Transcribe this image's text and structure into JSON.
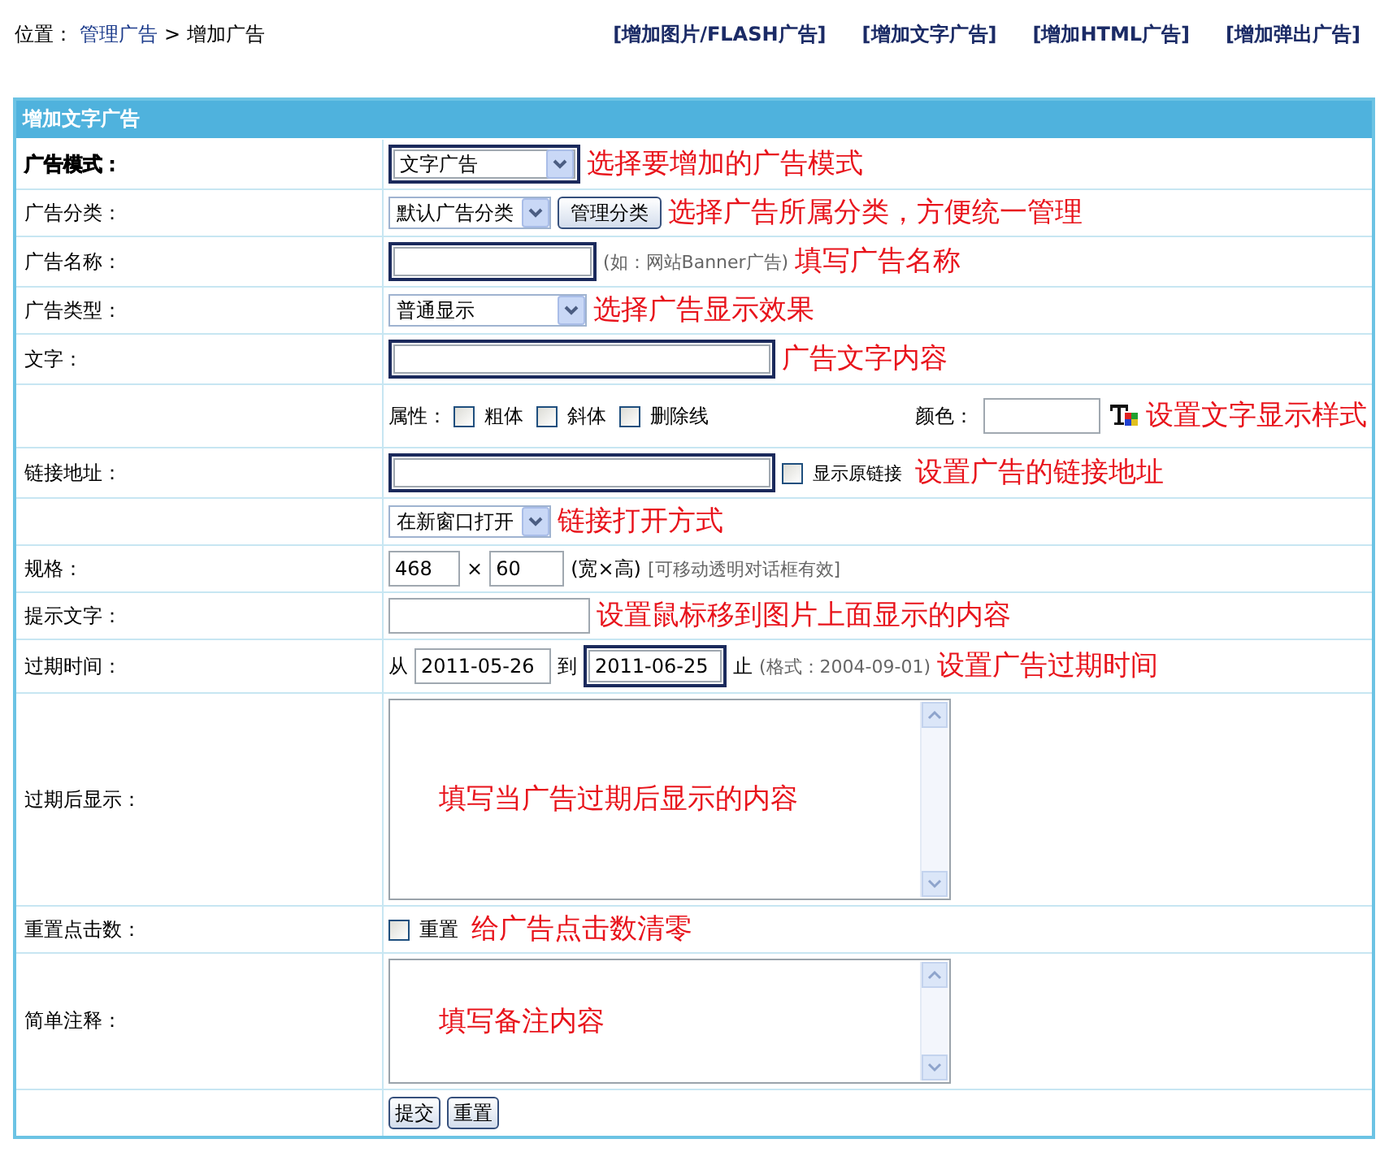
{
  "breadcrumb": {
    "prefix": "位置：",
    "link": "管理广告",
    "separator": ">",
    "current": "增加广告"
  },
  "top_links": [
    {
      "text": "[增加图片/FLASH广告]"
    },
    {
      "text": "[增加文字广告]"
    },
    {
      "text": "[增加HTML广告]"
    },
    {
      "text": "[增加弹出广告]"
    }
  ],
  "form": {
    "title": "增加文字广告",
    "rows": [
      {
        "label": "广告模式：",
        "emphasized": true,
        "items": [
          {
            "kind": "select",
            "value": "文字广告",
            "highlighted": true
          },
          {
            "kind": "annotation",
            "text": "选择要增加的广告模式"
          }
        ]
      },
      {
        "label": "广告分类：",
        "emphasized": false,
        "items": [
          {
            "kind": "select",
            "value": "默认广告分类",
            "highlighted": false
          },
          {
            "kind": "button",
            "text": "管理分类"
          },
          {
            "kind": "annotation",
            "text": "选择广告所属分类，方便统一管理"
          }
        ]
      },
      {
        "label": "广告名称：",
        "emphasized": false,
        "items": [
          {
            "kind": "input",
            "highlighted": true
          },
          {
            "kind": "hint",
            "text": "(如：网站Banner广告)"
          },
          {
            "kind": "annotation",
            "text": "填写广告名称"
          }
        ]
      },
      {
        "label": "广告类型：",
        "emphasized": false,
        "items": [
          {
            "kind": "select",
            "value": "普通显示",
            "highlighted": false
          },
          {
            "kind": "annotation",
            "text": "选择广告显示效果"
          }
        ]
      },
      {
        "label": "文字：",
        "emphasized": false,
        "items": [
          {
            "kind": "input",
            "highlighted": true
          },
          {
            "kind": "annotation",
            "text": "广告文字内容"
          }
        ]
      },
      {
        "items": [
          {
            "kind": "text",
            "text": "属性："
          },
          {
            "kind": "checkbox",
            "label": "粗体",
            "checked": false
          },
          {
            "kind": "checkbox",
            "label": "斜体",
            "checked": false
          },
          {
            "kind": "checkbox",
            "label": "删除线",
            "checked": false
          },
          {
            "kind": "color-picker",
            "label": "颜色：",
            "highlighted": false
          },
          {
            "kind": "annotation",
            "text": "设置文字显示样式"
          }
        ]
      },
      {
        "label": "链接地址：",
        "emphasized": false,
        "items": [
          {
            "kind": "input",
            "highlighted": true
          },
          {
            "kind": "checkbox",
            "label": "显示原链接",
            "checked": false
          },
          {
            "kind": "annotation",
            "text": "设置广告的链接地址"
          }
        ]
      },
      {
        "items": [
          {
            "kind": "select",
            "value": "在新窗口打开",
            "highlighted": false
          },
          {
            "kind": "annotation",
            "text": "链接打开方式"
          }
        ]
      },
      {
        "label": "规格：",
        "emphasized": false,
        "items": [
          {
            "kind": "input",
            "value": "468",
            "highlighted": false
          },
          {
            "kind": "text",
            "text": "×"
          },
          {
            "kind": "input",
            "value": "60",
            "highlighted": false
          },
          {
            "kind": "text",
            "text": "(宽×高)"
          },
          {
            "kind": "hint",
            "text": "[可移动透明对话框有效]"
          }
        ]
      },
      {
        "label": "提示文字：",
        "emphasized": false,
        "items": [
          {
            "kind": "input",
            "highlighted": false
          },
          {
            "kind": "annotation",
            "text": "设置鼠标移到图片上面显示的内容"
          }
        ]
      },
      {
        "label": "过期时间：",
        "emphasized": false,
        "items": [
          {
            "kind": "text",
            "text": "从"
          },
          {
            "kind": "input",
            "value": "2011-05-26",
            "highlighted": false
          },
          {
            "kind": "text",
            "text": "到"
          },
          {
            "kind": "input",
            "value": "2011-06-25",
            "highlighted": true
          },
          {
            "kind": "text",
            "text": "止"
          },
          {
            "kind": "hint",
            "text": "(格式：2004-09-01)"
          },
          {
            "kind": "annotation",
            "text": "设置广告过期时间"
          }
        ]
      },
      {
        "label": "过期后显示：",
        "emphasized": false,
        "items": [
          {
            "kind": "textarea",
            "annotation": "填写当广告过期后显示的内容",
            "highlighted": false
          }
        ]
      },
      {
        "label": "重置点击数：",
        "emphasized": false,
        "items": [
          {
            "kind": "checkbox",
            "label": "重置",
            "checked": false
          },
          {
            "kind": "annotation",
            "text": "给广告点击数清零"
          }
        ]
      },
      {
        "label": "简单注释：",
        "emphasized": false,
        "items": [
          {
            "kind": "textarea",
            "annotation": "填写备注内容",
            "highlighted": false
          }
        ]
      },
      {
        "items": [
          {
            "kind": "button",
            "text": "提交"
          },
          {
            "kind": "button",
            "text": "重置"
          }
        ]
      }
    ]
  }
}
